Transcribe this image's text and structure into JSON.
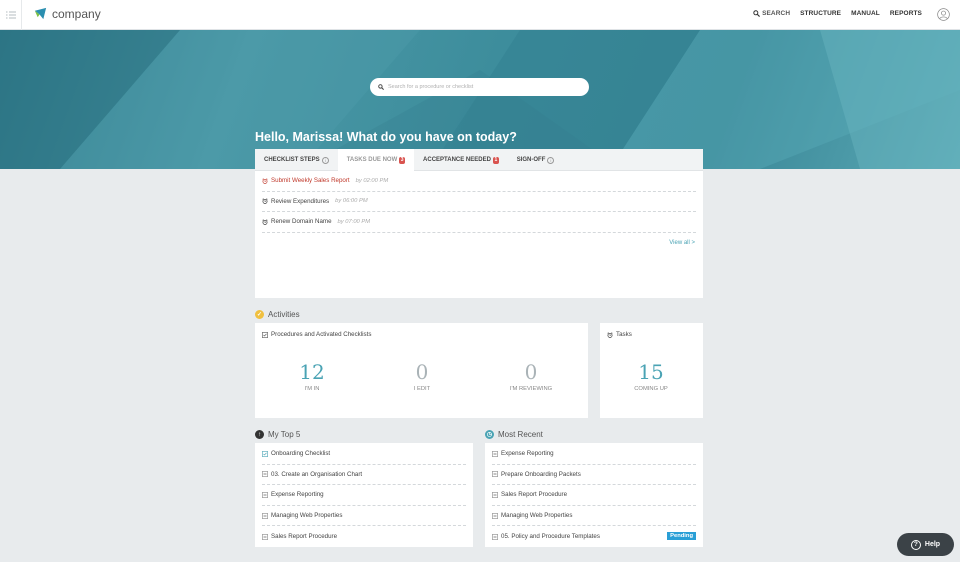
{
  "header": {
    "logo_text": "company",
    "nav": [
      {
        "label": "SEARCH"
      },
      {
        "label": "STRUCTURE"
      },
      {
        "label": "MANUAL"
      },
      {
        "label": "REPORTS"
      }
    ]
  },
  "hero": {
    "search_placeholder": "Search for a procedure or checklist",
    "greeting": "Hello, Marissa! What do you have on today?"
  },
  "task_tabs": [
    {
      "label": "CHECKLIST STEPS",
      "info": "i"
    },
    {
      "label": "TASKS DUE NOW",
      "badge": "3"
    },
    {
      "label": "ACCEPTANCE NEEDED",
      "badge": "1"
    },
    {
      "label": "SIGN-OFF",
      "info": "i"
    }
  ],
  "tasks": [
    {
      "title": "Submit Weekly Sales Report",
      "due": "by 02:00 PM"
    },
    {
      "title": "Review Expenditures",
      "due": "by 06:00 PM"
    },
    {
      "title": "Renew Domain Name",
      "due": "by 07:00 PM"
    }
  ],
  "view_all": "View all >",
  "activities": {
    "title": "Activities",
    "card_title": "Procedures and Activated Checklists",
    "stats": [
      {
        "value": "12",
        "label": "I'M IN"
      },
      {
        "value": "0",
        "label": "I EDIT"
      },
      {
        "value": "0",
        "label": "I'M REVIEWING"
      }
    ],
    "tasks_card": {
      "title": "Tasks",
      "value": "15",
      "label": "COMING UP"
    }
  },
  "my_top": {
    "title": "My Top 5",
    "items": [
      "Onboarding Checklist",
      "03. Create an Organisation Chart",
      "Expense Reporting",
      "Managing Web Properties",
      "Sales Report Procedure"
    ]
  },
  "most_recent": {
    "title": "Most Recent",
    "items": [
      "Expense Reporting",
      "Prepare Onboarding Packets",
      "Sales Report Procedure",
      "Managing Web Properties",
      "05. Policy and Procedure Templates"
    ],
    "pending_label": "Pending"
  },
  "help_label": "Help",
  "colors": {
    "accent": "#4aa3b4",
    "overdue": "#c0392b",
    "badge": "#d9534f",
    "pending": "#2a9fd6"
  }
}
